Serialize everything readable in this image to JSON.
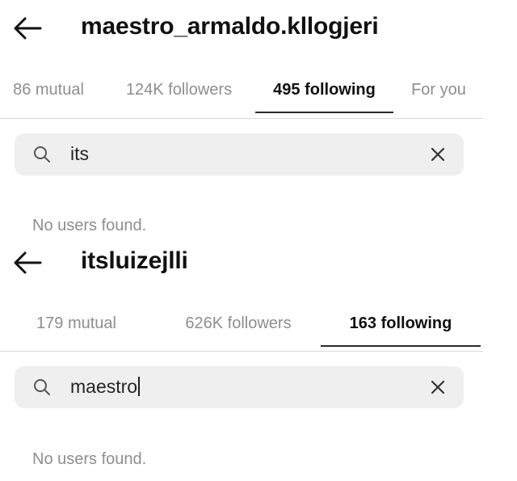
{
  "screens": [
    {
      "title": "maestro_armaldo.kllogjeri",
      "tabs": [
        {
          "label": "86 mutual"
        },
        {
          "label": "124K followers"
        },
        {
          "label": "495 following"
        },
        {
          "label": "For you"
        }
      ],
      "active_tab": 2,
      "search_value": "its",
      "empty_message": "No users found."
    },
    {
      "title": "itsluizejlli",
      "tabs": [
        {
          "label": "179 mutual"
        },
        {
          "label": "626K followers"
        },
        {
          "label": "163 following"
        }
      ],
      "active_tab": 2,
      "search_value": "maestro",
      "empty_message": "No users found."
    }
  ],
  "icons": {
    "back": "arrow-left-icon",
    "search": "search-icon",
    "clear": "close-icon"
  },
  "colors": {
    "text_primary": "#111111",
    "text_secondary": "#8e8e8e",
    "search_background": "#efefef",
    "tab_underline": "#2a2a2a"
  }
}
